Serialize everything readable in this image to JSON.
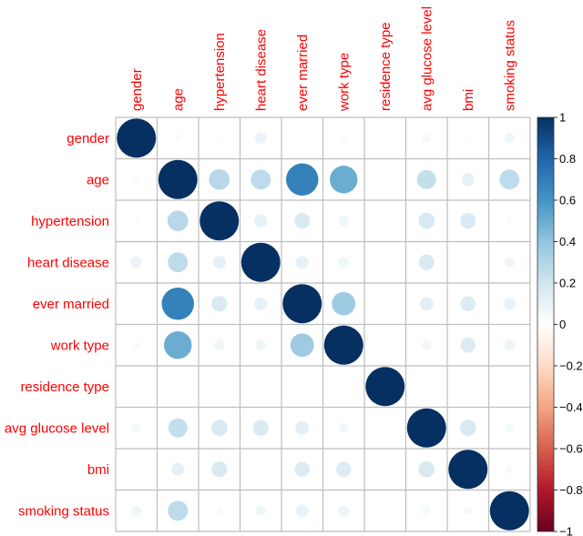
{
  "chart_data": {
    "type": "heatmap",
    "subtype": "correlation-matrix-circles",
    "title": "",
    "variables": [
      "gender",
      "age",
      "hypertension",
      "heart disease",
      "ever married",
      "work type",
      "residence type",
      "avg glucose level",
      "bmi",
      "smoking status"
    ],
    "matrix": [
      [
        1.0,
        0.03,
        0.02,
        0.09,
        0.01,
        0.03,
        0.0,
        0.05,
        0.02,
        0.07
      ],
      [
        0.03,
        1.0,
        0.28,
        0.26,
        0.68,
        0.5,
        0.01,
        0.24,
        0.11,
        0.26
      ],
      [
        0.02,
        0.28,
        1.0,
        0.11,
        0.16,
        0.07,
        0.0,
        0.17,
        0.16,
        0.03
      ],
      [
        0.09,
        0.26,
        0.11,
        1.0,
        0.11,
        0.07,
        0.0,
        0.16,
        0.01,
        0.07
      ],
      [
        0.01,
        0.68,
        0.16,
        0.11,
        1.0,
        0.36,
        0.01,
        0.12,
        0.15,
        0.1
      ],
      [
        0.03,
        0.5,
        0.07,
        0.07,
        0.36,
        1.0,
        0.01,
        0.06,
        0.15,
        0.08
      ],
      [
        0.0,
        0.01,
        0.0,
        0.0,
        0.01,
        0.01,
        1.0,
        0.0,
        0.0,
        0.0
      ],
      [
        0.05,
        0.24,
        0.17,
        0.16,
        0.12,
        0.06,
        0.0,
        1.0,
        0.17,
        0.05
      ],
      [
        0.02,
        0.11,
        0.16,
        0.01,
        0.15,
        0.15,
        0.0,
        0.17,
        1.0,
        0.04
      ],
      [
        0.07,
        0.26,
        0.03,
        0.07,
        0.1,
        0.08,
        0.0,
        0.05,
        0.04,
        1.0
      ]
    ],
    "value_range": [
      -1,
      1
    ],
    "colorbar": {
      "ticks": [
        "1",
        "0.8",
        "0.6",
        "0.4",
        "0.2",
        "0",
        "−0.2",
        "−0.4",
        "−0.6",
        "−0.8",
        "−1"
      ],
      "tick_values": [
        1,
        0.8,
        0.6,
        0.4,
        0.2,
        0,
        -0.2,
        -0.4,
        -0.6,
        -0.8,
        -1
      ],
      "placement": "right"
    },
    "palette": [
      "#67001F",
      "#B2182B",
      "#D6604D",
      "#F4A582",
      "#FDDBC7",
      "#FFFFFF",
      "#D1E5F0",
      "#92C5DE",
      "#4393C3",
      "#2166AC",
      "#053061"
    ],
    "label_color": "#FF0000",
    "grid": true,
    "grid_color": "#BEBEBE",
    "xlabel": "",
    "ylabel": ""
  }
}
